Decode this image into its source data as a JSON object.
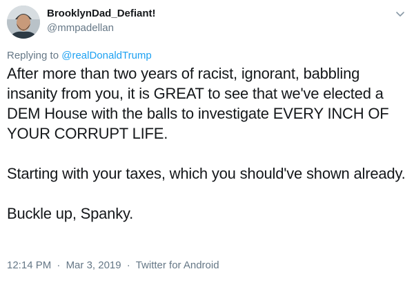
{
  "author": {
    "display_name": "BrooklynDad_Defiant!",
    "handle": "@mmpadellan",
    "avatar_icon": "profile-photo"
  },
  "reply": {
    "prefix": "Replying to ",
    "mention": "@realDonaldTrump"
  },
  "tweet": {
    "paragraphs": [
      "After more than two years of racist, ignorant, babbling insanity from you, it is GREAT to see that we've elected a DEM House with the balls to investigate EVERY INCH OF YOUR CORRUPT LIFE.",
      "Starting with your taxes, which you should've shown already.",
      "Buckle up, Spanky."
    ]
  },
  "meta": {
    "time": "12:14 PM",
    "separator": "·",
    "date": "Mar 3, 2019",
    "source": "Twitter for Android"
  },
  "colors": {
    "link": "#1da1f2",
    "muted": "#657786",
    "text": "#14171a"
  },
  "icons": {
    "menu": "chevron-down-icon"
  }
}
